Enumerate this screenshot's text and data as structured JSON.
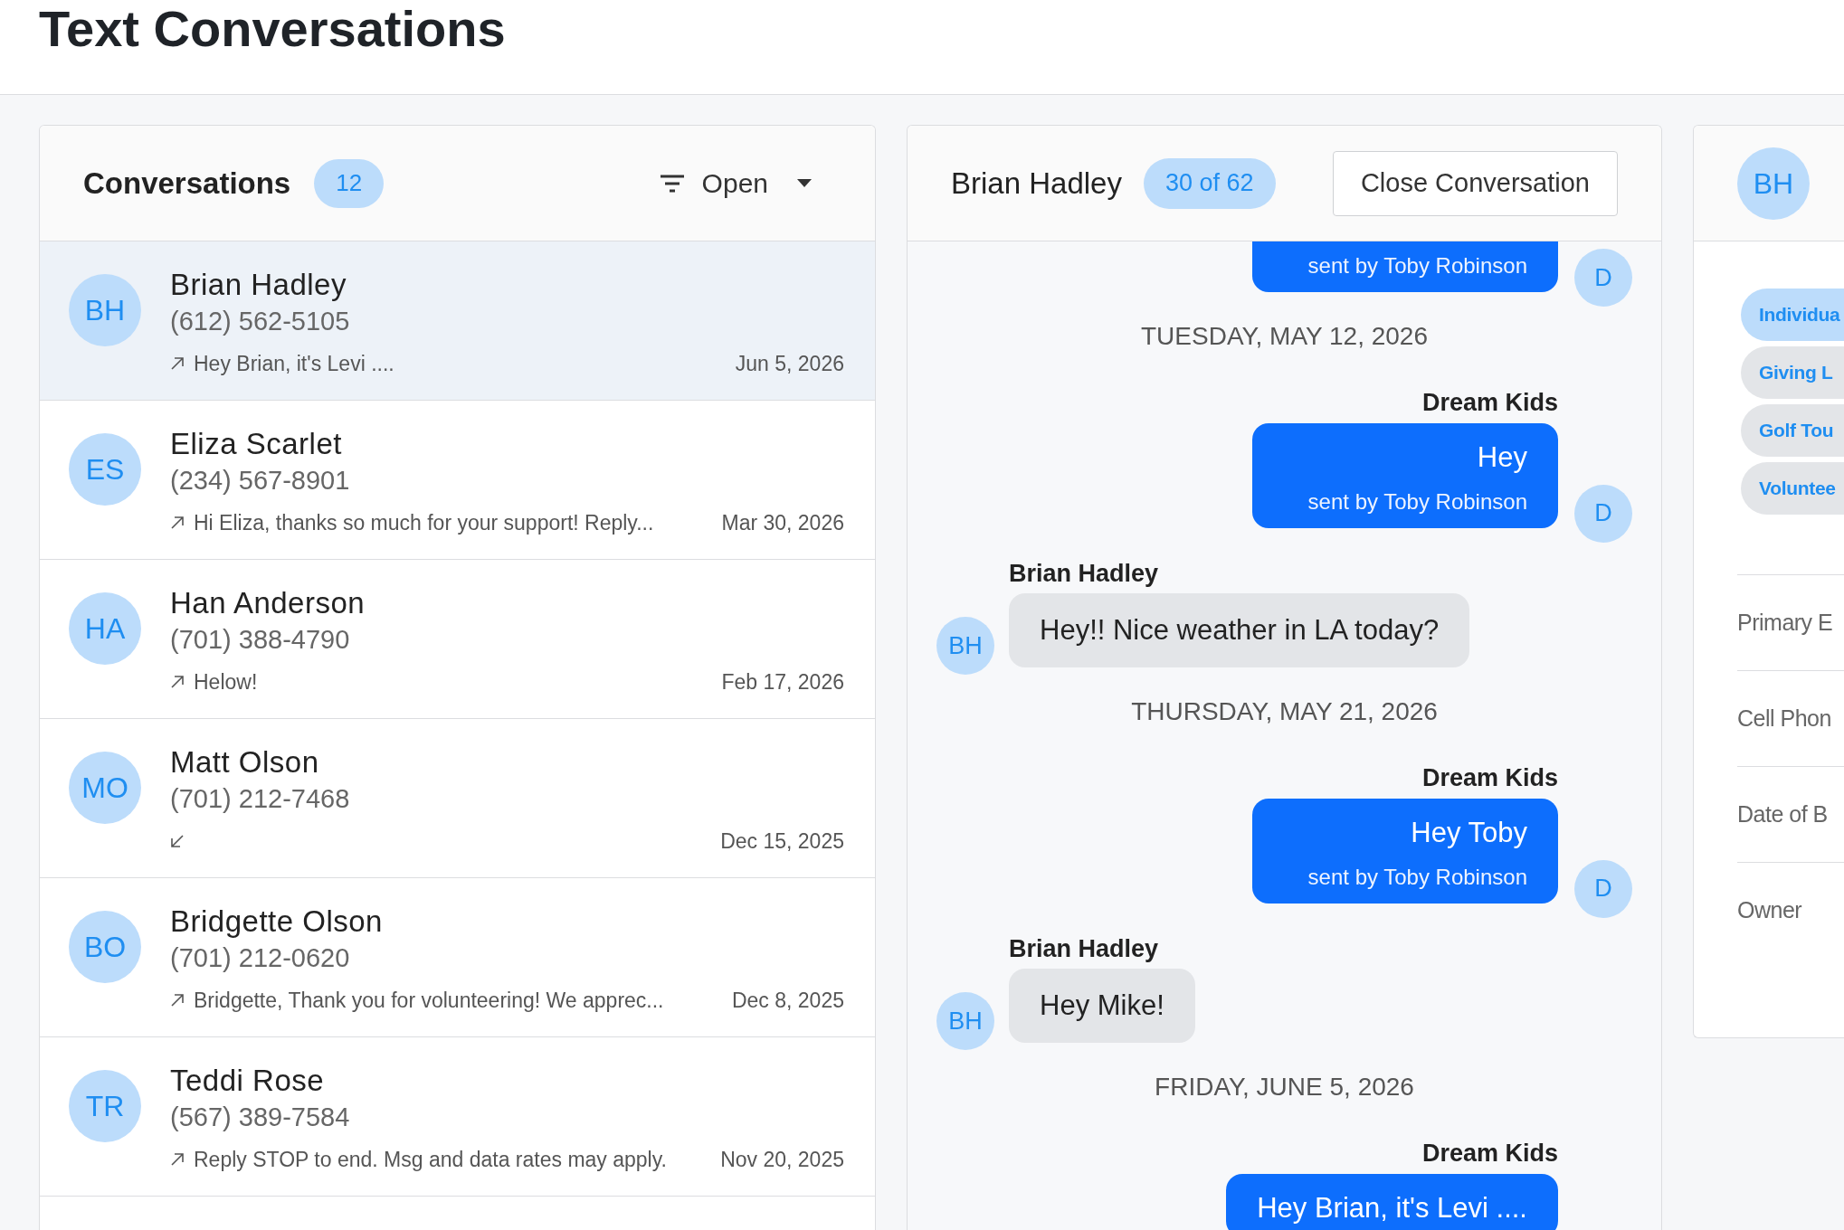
{
  "page_title": "Text Conversations",
  "conversations": {
    "title": "Conversations",
    "count": "12",
    "filter": "Open",
    "items": [
      {
        "initials": "BH",
        "name": "Brian Hadley",
        "phone": "(612) 562-5105",
        "outgoing": true,
        "preview": "Hey Brian, it's Levi ....",
        "date": "Jun 5, 2026",
        "selected": true
      },
      {
        "initials": "ES",
        "name": "Eliza Scarlet",
        "phone": "(234) 567-8901",
        "outgoing": true,
        "preview": "Hi Eliza, thanks so much for your support! Reply...",
        "date": "Mar 30, 2026",
        "selected": false
      },
      {
        "initials": "HA",
        "name": "Han Anderson",
        "phone": "(701) 388-4790",
        "outgoing": true,
        "preview": "Helow!",
        "date": "Feb 17, 2026",
        "selected": false
      },
      {
        "initials": "MO",
        "name": "Matt Olson",
        "phone": "(701) 212-7468",
        "outgoing": false,
        "date": "Dec 15, 2025",
        "selected": false
      },
      {
        "initials": "BO",
        "name": "Bridgette Olson",
        "phone": "(701) 212-0620",
        "outgoing": true,
        "preview": "Bridgette, Thank you for volunteering! We apprec...",
        "date": "Dec 8, 2025",
        "selected": false
      },
      {
        "initials": "TR",
        "name": "Teddi Rose",
        "phone": "(567) 389-7584",
        "outgoing": true,
        "preview": "Reply STOP to end. Msg and data rates may apply.",
        "date": "Nov 20, 2025",
        "selected": false
      }
    ]
  },
  "chat": {
    "name": "Brian Hadley",
    "position": "30 of 62",
    "close_button": "Close Conversation",
    "items": [
      {
        "kind": "sent",
        "sent_by": "sent by Toby Robinson",
        "avatar": "D"
      },
      {
        "kind": "date",
        "text": "TUESDAY, MAY 12, 2026"
      },
      {
        "kind": "sent",
        "sender": "Dream Kids",
        "text": "Hey",
        "sent_by": "sent by Toby Robinson",
        "avatar": "D"
      },
      {
        "kind": "received",
        "sender": "Brian Hadley",
        "text": "Hey!! Nice weather in LA today?",
        "avatar": "BH"
      },
      {
        "kind": "date",
        "text": "THURSDAY, MAY 21, 2026"
      },
      {
        "kind": "sent",
        "sender": "Dream Kids",
        "text": "Hey Toby",
        "sent_by": "sent by Toby Robinson",
        "avatar": "D"
      },
      {
        "kind": "received",
        "sender": "Brian Hadley",
        "text": "Hey Mike!",
        "avatar": "BH"
      },
      {
        "kind": "date",
        "text": "FRIDAY, JUNE 5, 2026"
      },
      {
        "kind": "sent",
        "sender": "Dream Kids",
        "text": "Hey Brian, it's Levi ...."
      }
    ]
  },
  "contact": {
    "initials": "BH",
    "tags": [
      {
        "label": "Individua",
        "active": true
      },
      {
        "label": "Giving L",
        "active": false
      },
      {
        "label": "Golf Tou",
        "active": false
      },
      {
        "label": "Voluntee",
        "active": false
      }
    ],
    "fields": [
      "Primary E",
      "Cell Phon",
      "Date of B",
      "Owner"
    ]
  }
}
